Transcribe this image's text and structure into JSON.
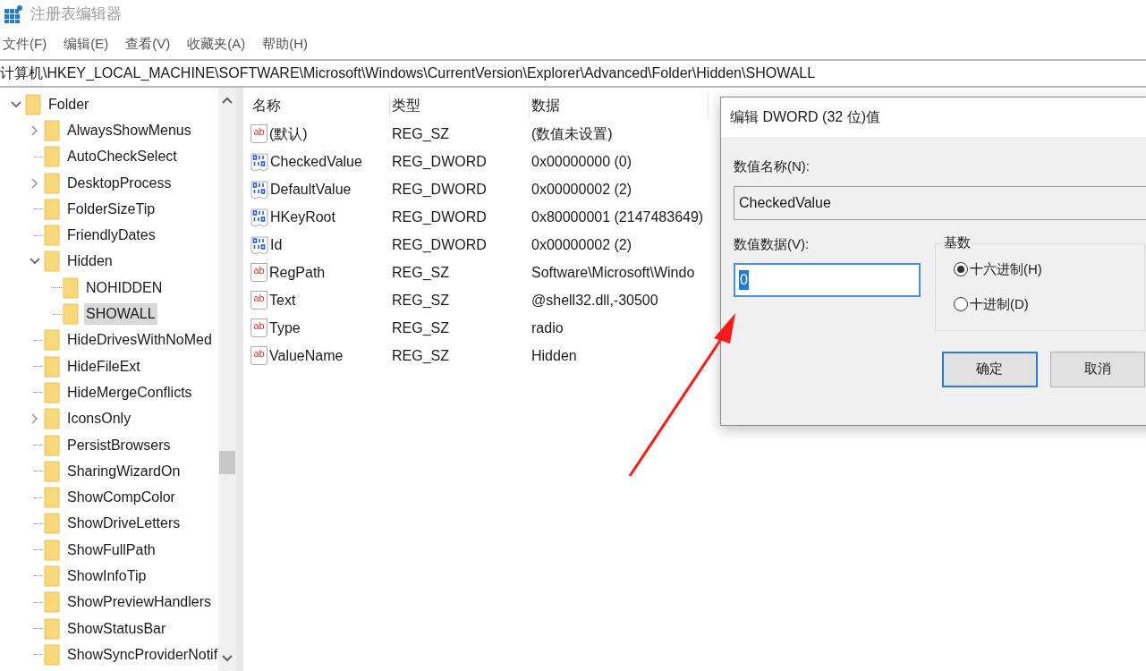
{
  "window": {
    "title": "注册表编辑器"
  },
  "menu": [
    "文件(F)",
    "编辑(E)",
    "查看(V)",
    "收藏夹(A)",
    "帮助(H)"
  ],
  "address": "计算机\\HKEY_LOCAL_MACHINE\\SOFTWARE\\Microsoft\\Windows\\CurrentVersion\\Explorer\\Advanced\\Folder\\Hidden\\SHOWALL",
  "tree": [
    {
      "label": "Folder",
      "expandable": true,
      "expanded": true,
      "selected": false,
      "children": [
        {
          "label": "AlwaysShowMenus",
          "expandable": true,
          "expanded": false,
          "selected": false
        },
        {
          "label": "AutoCheckSelect",
          "expandable": false,
          "expanded": false,
          "selected": false
        },
        {
          "label": "DesktopProcess",
          "expandable": true,
          "expanded": false,
          "selected": false
        },
        {
          "label": "FolderSizeTip",
          "expandable": false,
          "expanded": false,
          "selected": false
        },
        {
          "label": "FriendlyDates",
          "expandable": false,
          "expanded": false,
          "selected": false
        },
        {
          "label": "Hidden",
          "expandable": true,
          "expanded": true,
          "selected": false,
          "children": [
            {
              "label": "NOHIDDEN",
              "expandable": false,
              "expanded": false,
              "selected": false
            },
            {
              "label": "SHOWALL",
              "expandable": false,
              "expanded": false,
              "selected": true
            }
          ]
        },
        {
          "label": "HideDrivesWithNoMed",
          "expandable": false,
          "expanded": false,
          "selected": false
        },
        {
          "label": "HideFileExt",
          "expandable": false,
          "expanded": false,
          "selected": false
        },
        {
          "label": "HideMergeConflicts",
          "expandable": false,
          "expanded": false,
          "selected": false
        },
        {
          "label": "IconsOnly",
          "expandable": true,
          "expanded": false,
          "selected": false
        },
        {
          "label": "PersistBrowsers",
          "expandable": false,
          "expanded": false,
          "selected": false
        },
        {
          "label": "SharingWizardOn",
          "expandable": false,
          "expanded": false,
          "selected": false
        },
        {
          "label": "ShowCompColor",
          "expandable": false,
          "expanded": false,
          "selected": false
        },
        {
          "label": "ShowDriveLetters",
          "expandable": false,
          "expanded": false,
          "selected": false
        },
        {
          "label": "ShowFullPath",
          "expandable": false,
          "expanded": false,
          "selected": false
        },
        {
          "label": "ShowInfoTip",
          "expandable": false,
          "expanded": false,
          "selected": false
        },
        {
          "label": "ShowPreviewHandlers",
          "expandable": false,
          "expanded": false,
          "selected": false
        },
        {
          "label": "ShowStatusBar",
          "expandable": false,
          "expanded": false,
          "selected": false
        },
        {
          "label": "ShowSyncProviderNotif",
          "expandable": false,
          "expanded": false,
          "selected": false
        }
      ]
    }
  ],
  "table": {
    "columns": [
      "名称",
      "类型",
      "数据"
    ],
    "rows": [
      {
        "kind": "string",
        "icon_text": "ab",
        "name": "(默认)",
        "type": "REG_SZ",
        "data": "(数值未设置)"
      },
      {
        "kind": "binary",
        "name": "CheckedValue",
        "type": "REG_DWORD",
        "data": "0x00000000 (0)"
      },
      {
        "kind": "binary",
        "name": "DefaultValue",
        "type": "REG_DWORD",
        "data": "0x00000002 (2)"
      },
      {
        "kind": "binary",
        "name": "HKeyRoot",
        "type": "REG_DWORD",
        "data": "0x80000001 (2147483649)"
      },
      {
        "kind": "binary",
        "name": "Id",
        "type": "REG_DWORD",
        "data": "0x00000002 (2)"
      },
      {
        "kind": "string",
        "icon_text": "ab",
        "name": "RegPath",
        "type": "REG_SZ",
        "data": "Software\\Microsoft\\Windo"
      },
      {
        "kind": "string",
        "icon_text": "ab",
        "name": "Text",
        "type": "REG_SZ",
        "data": "@shell32.dll,-30500"
      },
      {
        "kind": "string",
        "icon_text": "ab",
        "name": "Type",
        "type": "REG_SZ",
        "data": "radio"
      },
      {
        "kind": "string",
        "icon_text": "ab",
        "name": "ValueName",
        "type": "REG_SZ",
        "data": "Hidden"
      }
    ]
  },
  "dialog": {
    "title": "编辑 DWORD (32 位)值",
    "name_label": "数值名称(N):",
    "name_value": "CheckedValue",
    "data_label": "数值数据(V):",
    "data_value": "0",
    "base_label": "基数",
    "radios": [
      {
        "label": "十六进制(H)",
        "selected": true
      },
      {
        "label": "十进制(D)",
        "selected": false
      }
    ],
    "buttons": [
      {
        "label": "确定",
        "default": true
      },
      {
        "label": "取消",
        "default": false
      }
    ]
  }
}
